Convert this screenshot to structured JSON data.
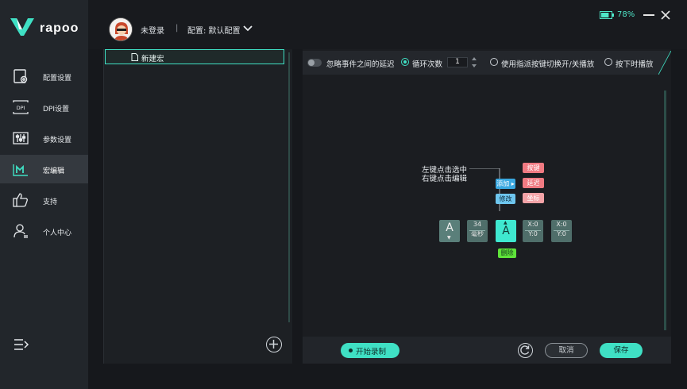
{
  "brand": {
    "wordmark": "rapoo"
  },
  "sidebar": {
    "items": [
      {
        "label": "配置设置",
        "icon": "config-icon",
        "active": false
      },
      {
        "label": "DPI设置",
        "icon": "dpi-icon",
        "active": false
      },
      {
        "label": "参数设置",
        "icon": "sliders-icon",
        "active": false
      },
      {
        "label": "宏编辑",
        "icon": "macro-icon",
        "active": true
      },
      {
        "label": "支持",
        "icon": "thumbs-up-icon",
        "active": false
      },
      {
        "label": "个人中心",
        "icon": "user-icon",
        "active": false
      }
    ],
    "menu_icon": "menu-expand-icon"
  },
  "header": {
    "login_status": "未登录",
    "separator": "|",
    "config_label": "配置: 默认配置",
    "battery_percent": "78%",
    "battery_level": 0.78
  },
  "macro_list": {
    "items": [
      {
        "label": "新建宏",
        "selected": true
      }
    ]
  },
  "options": {
    "ignore_delay_label": "忽略事件之间的延迟",
    "loop_count_label": "循环次数",
    "loop_count_value": "1",
    "toggle_label": "使用指派按键切换开/关播放",
    "press_play_label": "按下时播放",
    "selected_mode": "loop"
  },
  "editor": {
    "hint_line1": "左键点击选中",
    "hint_line2": "右键点击编辑",
    "add_label": "添加",
    "modify_label": "修改",
    "menu_key": "按键",
    "menu_delay": "延迟",
    "menu_coord": "坐标",
    "sequence": {
      "key1": "A",
      "delay_value": "34",
      "delay_unit": "毫秒",
      "key2": "A",
      "coord1_x": "X:0",
      "coord1_y": "Y:0",
      "coord2_x": "X:0",
      "coord2_y": "Y:0"
    },
    "delete_label": "删除"
  },
  "footer": {
    "record_label": "开始录制",
    "cancel_label": "取消",
    "save_label": "保存"
  },
  "colors": {
    "accent": "#3fe0c4",
    "sidebar_bg": "#22262b",
    "active_bg": "#34393f"
  }
}
